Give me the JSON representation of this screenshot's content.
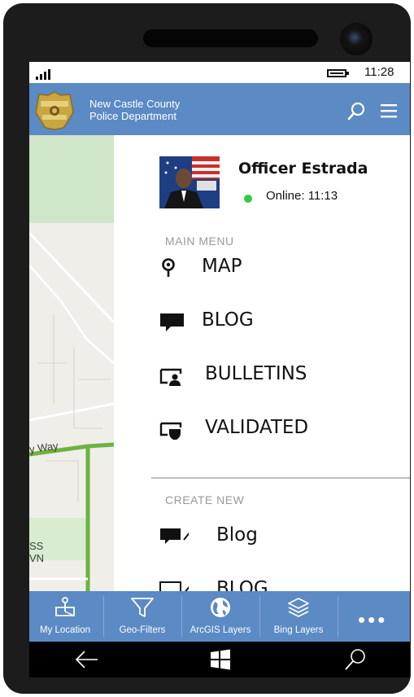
{
  "status_bar": {
    "time": "11:28"
  },
  "app_bar": {
    "title_line1": "New Castle County",
    "title_line2": "Police Department",
    "badge_icon": "police-badge-icon",
    "search_icon": "search-icon",
    "menu_icon": "hamburger-menu-icon",
    "color": "#5b8ac4"
  },
  "map": {
    "road_label": "y Way",
    "area_label_line1": "SS",
    "area_label_line2": "VN",
    "highlight_route_color": "#6db33f"
  },
  "drawer": {
    "officer_name": "Officer Estrada",
    "online_status": "Online: 11:13",
    "online_color": "#2ecc40",
    "main_menu_header": "MAIN MENU",
    "main_menu": [
      {
        "label": "MAP",
        "icon": "map-pin-icon"
      },
      {
        "label": "BLOG",
        "icon": "speech-bubble-icon"
      },
      {
        "label": "BULLETINS",
        "icon": "bulletin-person-icon"
      },
      {
        "label": "VALIDATED",
        "icon": "validated-shield-icon"
      }
    ],
    "create_new_header": "CREATE NEW",
    "create_new": [
      {
        "label": "Blog",
        "icon": "new-blog-icon"
      },
      {
        "label": "BLOG",
        "icon": "new-blog-icon"
      }
    ]
  },
  "bottom_bar": {
    "buttons": [
      {
        "label": "My Location",
        "icon": "my-location-icon"
      },
      {
        "label": "Geo-Filters",
        "icon": "filter-icon"
      },
      {
        "label": "ArcGIS Layers",
        "icon": "globe-icon"
      },
      {
        "label": "Bing Layers",
        "icon": "layers-icon"
      }
    ],
    "more_label": "•••"
  },
  "system_nav": {
    "back_icon": "back-arrow-icon",
    "start_icon": "windows-start-icon",
    "search_icon": "search-icon"
  }
}
